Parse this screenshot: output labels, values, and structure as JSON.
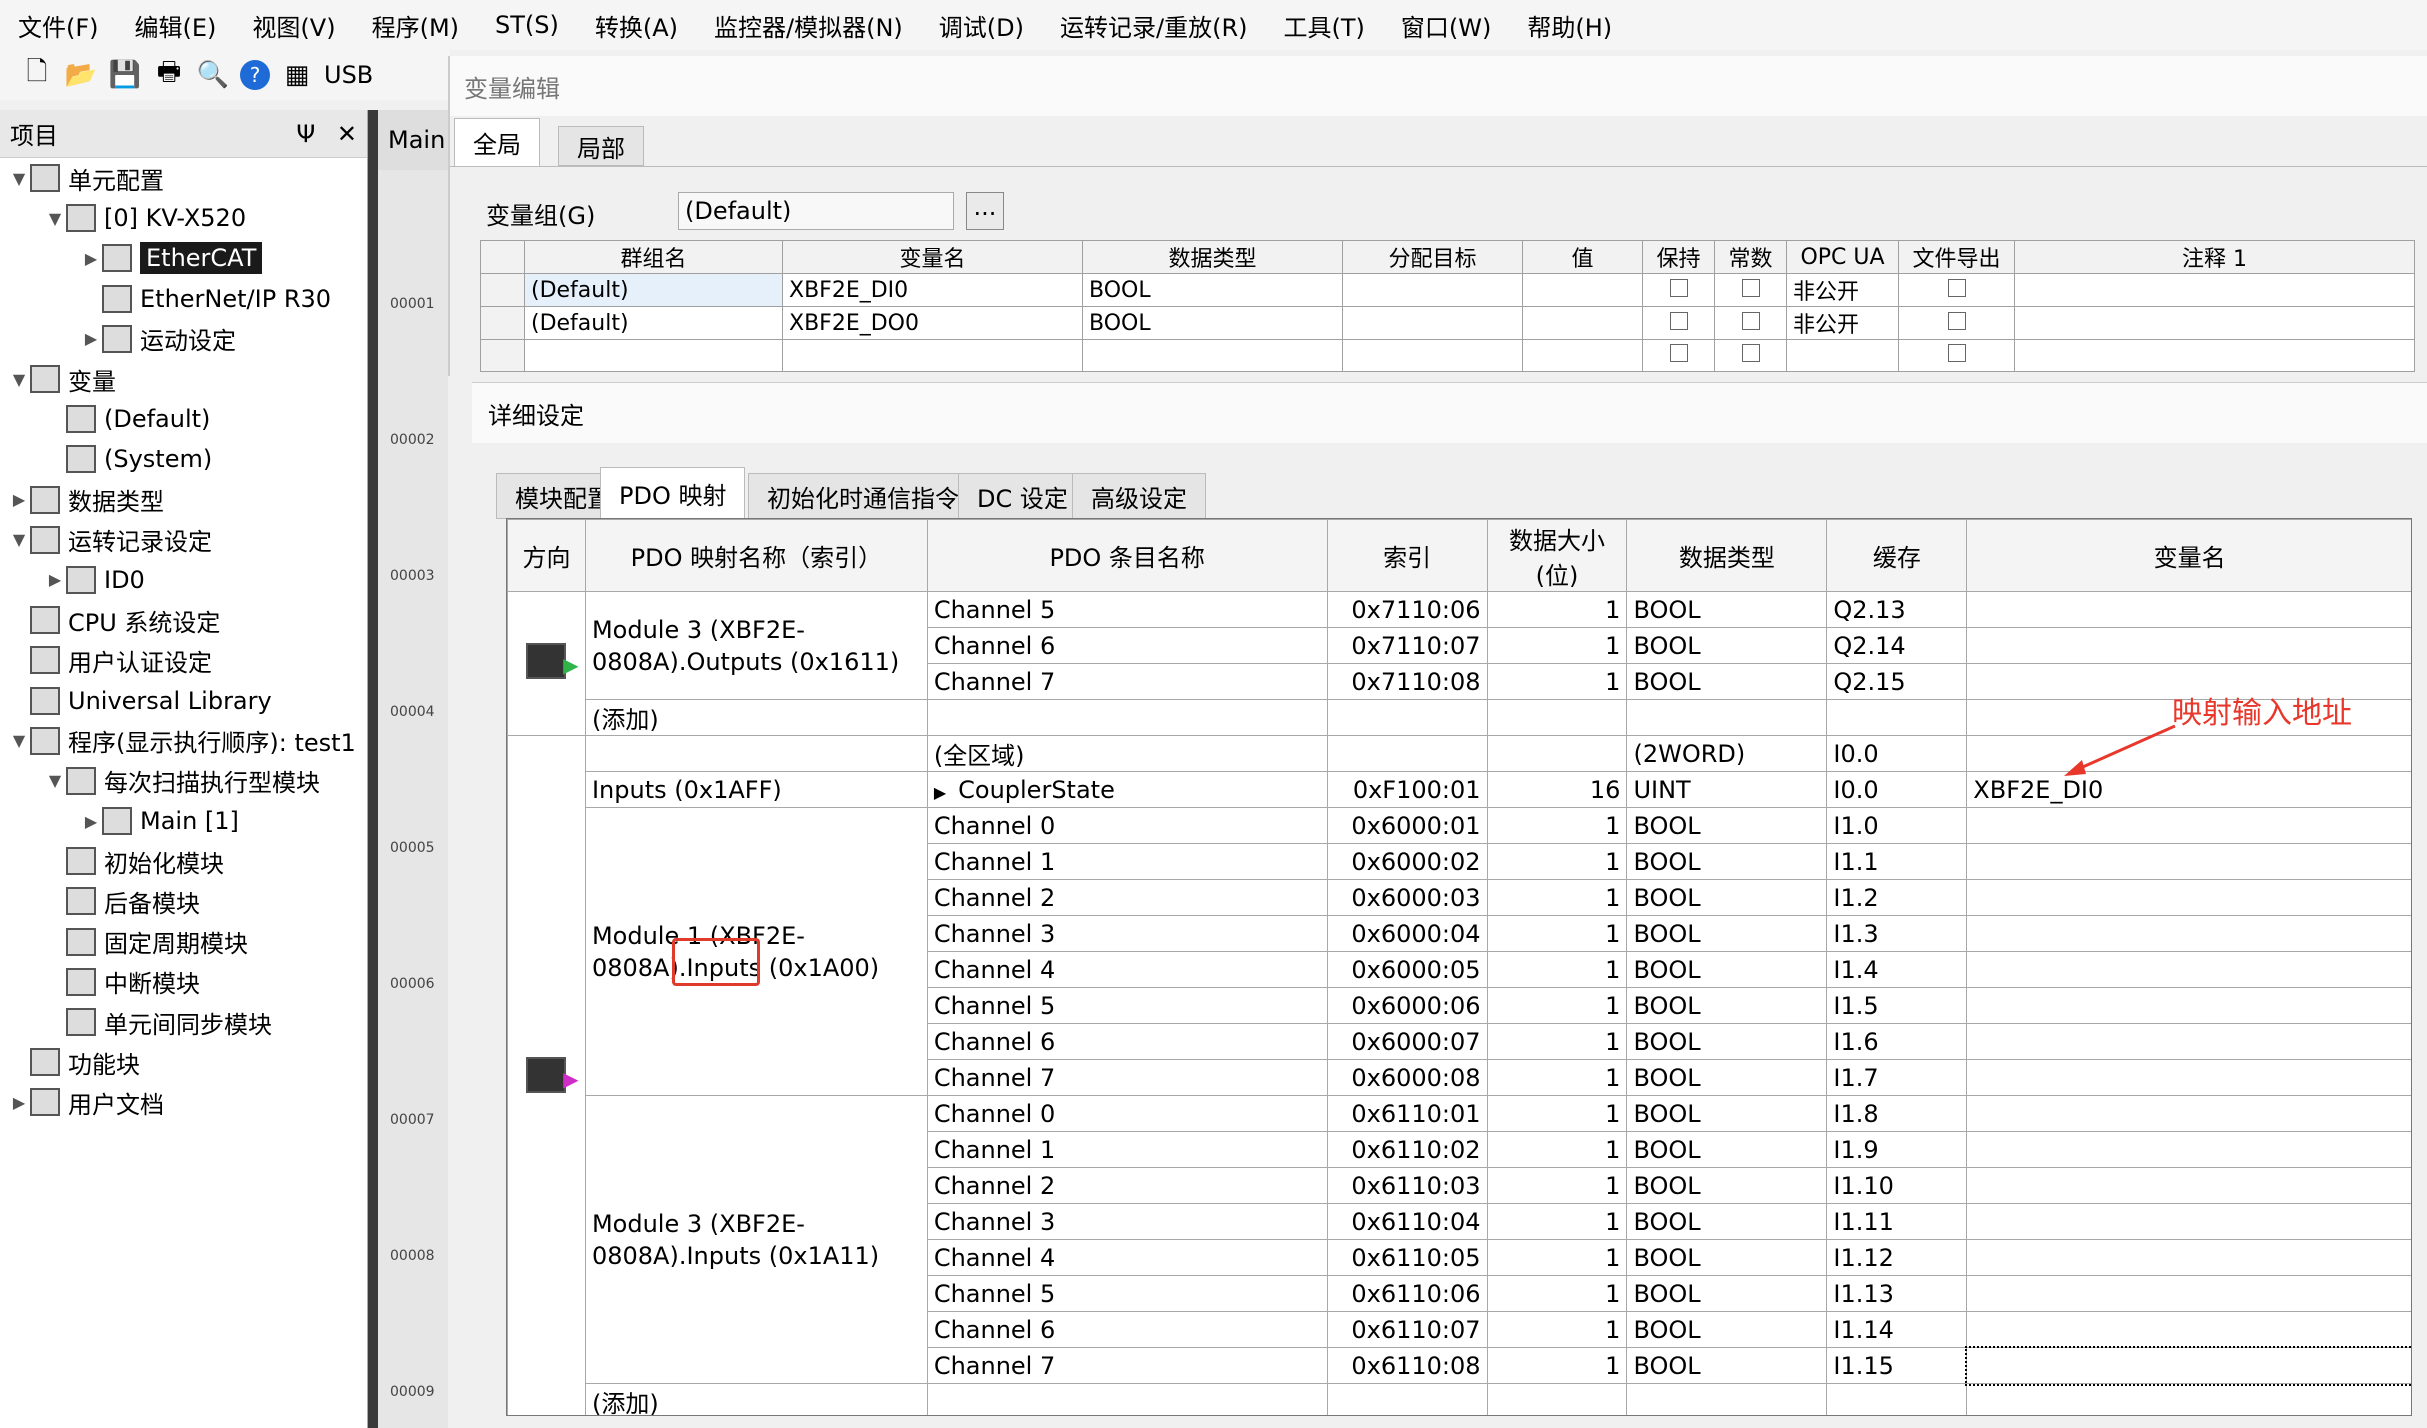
{
  "menu": [
    "文件(F)",
    "编辑(E)",
    "视图(V)",
    "程序(M)",
    "ST(S)",
    "转换(A)",
    "监控器/模拟器(N)",
    "调试(D)",
    "运转记录/重放(R)",
    "工具(T)",
    "窗口(W)",
    "帮助(H)"
  ],
  "toolbar": {
    "usb_label": "USB"
  },
  "project": {
    "title": "项目",
    "pin": "Ψ",
    "close": "✕",
    "tree": [
      {
        "label": "单元配置",
        "indent": 0,
        "arrow": "▼"
      },
      {
        "label": "[0]  KV-X520",
        "indent": 1,
        "arrow": "▼"
      },
      {
        "label": "EtherCAT",
        "indent": 2,
        "arrow": "▶",
        "selected": true
      },
      {
        "label": "EtherNet/IP   R30",
        "indent": 2,
        "arrow": ""
      },
      {
        "label": "运动设定",
        "indent": 2,
        "arrow": "▶"
      },
      {
        "label": "变量",
        "indent": 0,
        "arrow": "▼"
      },
      {
        "label": "(Default)",
        "indent": 1,
        "arrow": ""
      },
      {
        "label": "(System)",
        "indent": 1,
        "arrow": ""
      },
      {
        "label": "数据类型",
        "indent": 0,
        "arrow": "▶"
      },
      {
        "label": "运转记录设定",
        "indent": 0,
        "arrow": "▼"
      },
      {
        "label": "ID0",
        "indent": 1,
        "arrow": "▶"
      },
      {
        "label": "CPU 系统设定",
        "indent": 0,
        "arrow": ""
      },
      {
        "label": "用户认证设定",
        "indent": 0,
        "arrow": ""
      },
      {
        "label": "Universal Library",
        "indent": 0,
        "arrow": ""
      },
      {
        "label": "程序(显示执行顺序): test1",
        "indent": 0,
        "arrow": "▼"
      },
      {
        "label": "每次扫描执行型模块",
        "indent": 1,
        "arrow": "▼"
      },
      {
        "label": "Main [1]",
        "indent": 2,
        "arrow": "▶"
      },
      {
        "label": "初始化模块",
        "indent": 1,
        "arrow": ""
      },
      {
        "label": "后备模块",
        "indent": 1,
        "arrow": ""
      },
      {
        "label": "固定周期模块",
        "indent": 1,
        "arrow": ""
      },
      {
        "label": "中断模块",
        "indent": 1,
        "arrow": ""
      },
      {
        "label": "单元间同步模块",
        "indent": 1,
        "arrow": ""
      },
      {
        "label": "功能块",
        "indent": 0,
        "arrow": ""
      },
      {
        "label": "用户文档",
        "indent": 0,
        "arrow": "▶"
      }
    ]
  },
  "editor": {
    "tab_label": "Main",
    "line_numbers": [
      "00001",
      "00002",
      "00003",
      "00004",
      "00005",
      "00006",
      "00007",
      "00008",
      "00009"
    ]
  },
  "var_edit": {
    "title": "变量编辑",
    "tabs": [
      "全局",
      "局部"
    ],
    "group_label": "变量组(G)",
    "group_value": "(Default)",
    "browse": "...",
    "columns": [
      "",
      "群组名",
      "变量名",
      "数据类型",
      "分配目标",
      "值",
      "保持",
      "常数",
      "OPC UA",
      "文件导出",
      "注释 1"
    ],
    "rows": [
      {
        "group": "(Default)",
        "name": "XBF2E_DI0",
        "type": "BOOL",
        "opc": "非公开"
      },
      {
        "group": "(Default)",
        "name": "XBF2E_DO0",
        "type": "BOOL",
        "opc": "非公开"
      },
      {
        "group": "",
        "name": "",
        "type": "",
        "opc": ""
      }
    ]
  },
  "detail": {
    "title": "详细设定",
    "tabs": [
      "模块配置",
      "PDO 映射",
      "初始化时通信指令",
      "DC 设定",
      "高级设定"
    ],
    "columns": [
      "方向",
      "PDO 映射名称（索引）",
      "PDO 条目名称",
      "索引",
      "数据大小(位)",
      "数据类型",
      "缓存",
      "变量名"
    ],
    "outputs_group": {
      "name": "Module 3 (XBF2E-0808A).Outputs (0x1611)",
      "rows": [
        {
          "entry": "Channel 5",
          "index": "0x7110:06",
          "size": "1",
          "type": "BOOL",
          "buf": "Q2.13"
        },
        {
          "entry": "Channel 6",
          "index": "0x7110:07",
          "size": "1",
          "type": "BOOL",
          "buf": "Q2.14"
        },
        {
          "entry": "Channel 7",
          "index": "0x7110:08",
          "size": "1",
          "type": "BOOL",
          "buf": "Q2.15"
        }
      ],
      "add": "(添加)"
    },
    "all_area": {
      "entry": "(全区域)",
      "type": "(2WORD)",
      "buf": "I0.0"
    },
    "inputs_row": {
      "name": "Inputs (0x1AFF)",
      "entry": "CouplerState",
      "index": "0xF100:01",
      "size": "16",
      "type": "UINT",
      "buf": "I0.0",
      "var": "XBF2E_DI0"
    },
    "module1": {
      "name": "Module 1 (XBF2E-0808A).Inputs (0x1A00)",
      "rows": [
        {
          "entry": "Channel 0",
          "index": "0x6000:01",
          "size": "1",
          "type": "BOOL",
          "buf": "I1.0"
        },
        {
          "entry": "Channel 1",
          "index": "0x6000:02",
          "size": "1",
          "type": "BOOL",
          "buf": "I1.1"
        },
        {
          "entry": "Channel 2",
          "index": "0x6000:03",
          "size": "1",
          "type": "BOOL",
          "buf": "I1.2"
        },
        {
          "entry": "Channel 3",
          "index": "0x6000:04",
          "size": "1",
          "type": "BOOL",
          "buf": "I1.3"
        },
        {
          "entry": "Channel 4",
          "index": "0x6000:05",
          "size": "1",
          "type": "BOOL",
          "buf": "I1.4"
        },
        {
          "entry": "Channel 5",
          "index": "0x6000:06",
          "size": "1",
          "type": "BOOL",
          "buf": "I1.5"
        },
        {
          "entry": "Channel 6",
          "index": "0x6000:07",
          "size": "1",
          "type": "BOOL",
          "buf": "I1.6"
        },
        {
          "entry": "Channel 7",
          "index": "0x6000:08",
          "size": "1",
          "type": "BOOL",
          "buf": "I1.7"
        }
      ]
    },
    "module3": {
      "name": "Module 3 (XBF2E-0808A).Inputs (0x1A11)",
      "rows": [
        {
          "entry": "Channel 0",
          "index": "0x6110:01",
          "size": "1",
          "type": "BOOL",
          "buf": "I1.8"
        },
        {
          "entry": "Channel 1",
          "index": "0x6110:02",
          "size": "1",
          "type": "BOOL",
          "buf": "I1.9"
        },
        {
          "entry": "Channel 2",
          "index": "0x6110:03",
          "size": "1",
          "type": "BOOL",
          "buf": "I1.10"
        },
        {
          "entry": "Channel 3",
          "index": "0x6110:04",
          "size": "1",
          "type": "BOOL",
          "buf": "I1.11"
        },
        {
          "entry": "Channel 4",
          "index": "0x6110:05",
          "size": "1",
          "type": "BOOL",
          "buf": "I1.12"
        },
        {
          "entry": "Channel 5",
          "index": "0x6110:06",
          "size": "1",
          "type": "BOOL",
          "buf": "I1.13"
        },
        {
          "entry": "Channel 6",
          "index": "0x6110:07",
          "size": "1",
          "type": "BOOL",
          "buf": "I1.14"
        },
        {
          "entry": "Channel 7",
          "index": "0x6110:08",
          "size": "1",
          "type": "BOOL",
          "buf": "I1.15"
        }
      ]
    },
    "add": "(添加)"
  },
  "annotation": {
    "text": "映射输入地址",
    "color": "#e8382c"
  }
}
